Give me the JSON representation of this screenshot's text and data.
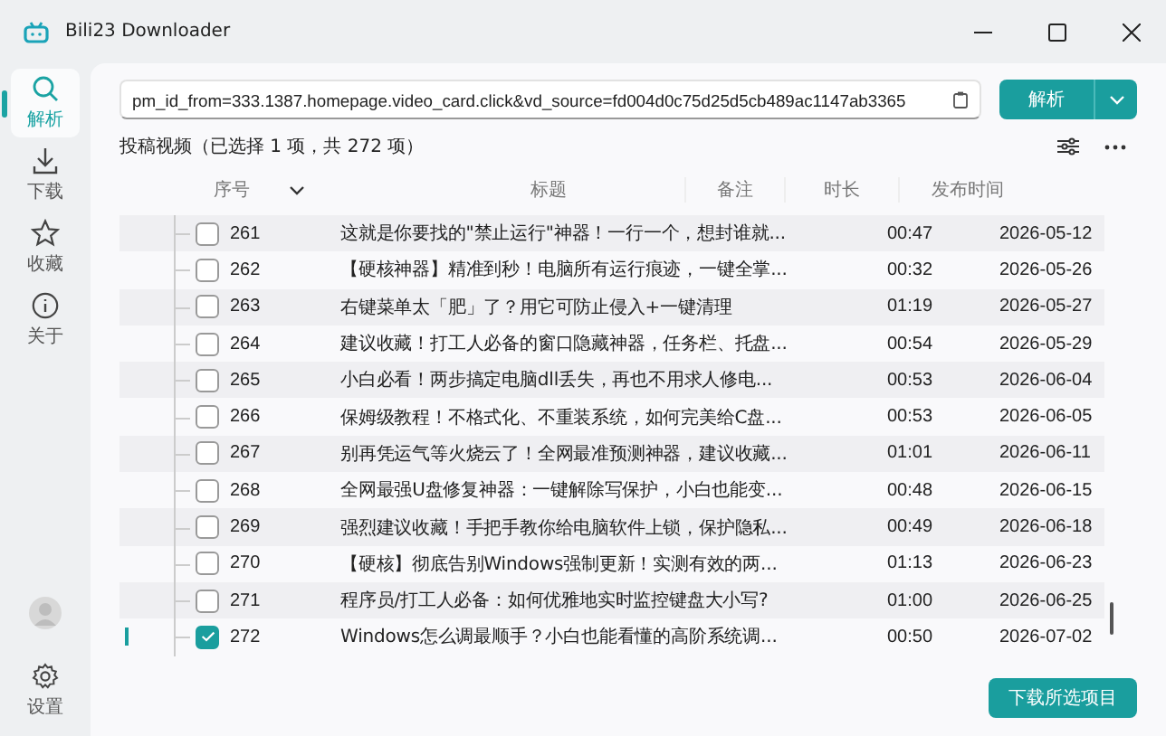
{
  "window": {
    "title": "Bili23 Downloader"
  },
  "sidebar": {
    "items": [
      {
        "label": "解析",
        "kind": "search",
        "selected": true
      },
      {
        "label": "下载",
        "kind": "download",
        "selected": false
      },
      {
        "label": "收藏",
        "kind": "star",
        "selected": false
      },
      {
        "label": "关于",
        "kind": "info",
        "selected": false
      }
    ],
    "settings": {
      "label": "设置"
    }
  },
  "url_field": {
    "value": "pm_id_from=333.1387.homepage.video_card.click&vd_source=fd004d0c75d25d5cb489ac1147ab3365"
  },
  "parse_button": {
    "label": "解析"
  },
  "list_title": "投稿视频（已选择 1 项，共 272 项）",
  "table": {
    "columns": [
      "序号",
      "标题",
      "备注",
      "时长",
      "发布时间"
    ],
    "rows": [
      {
        "number": "261",
        "title": "这就是你要找的\"禁止运行\"神器！一行一个，想封谁就...",
        "duration": "00:47",
        "date": "2026-05-12",
        "selected": false
      },
      {
        "number": "262",
        "title": "【硬核神器】精准到秒！电脑所有运行痕迹，一键全掌...",
        "duration": "00:32",
        "date": "2026-05-26",
        "selected": false
      },
      {
        "number": "263",
        "title": "右键菜单太「肥」了？用它可防止侵入+一键清理",
        "duration": "01:19",
        "date": "2026-05-27",
        "selected": false
      },
      {
        "number": "264",
        "title": "建议收藏！打工人必备的窗口隐藏神器，任务栏、托盘...",
        "duration": "00:54",
        "date": "2026-05-29",
        "selected": false
      },
      {
        "number": "265",
        "title": "小白必看！两步搞定电脑dll丢失，再也不用求人修电...",
        "duration": "00:53",
        "date": "2026-06-04",
        "selected": false
      },
      {
        "number": "266",
        "title": "保姆级教程！不格式化、不重装系统，如何完美给C盘...",
        "duration": "00:53",
        "date": "2026-06-05",
        "selected": false
      },
      {
        "number": "267",
        "title": "别再凭运气等火烧云了！全网最准预测神器，建议收藏...",
        "duration": "01:01",
        "date": "2026-06-11",
        "selected": false
      },
      {
        "number": "268",
        "title": "全网最强U盘修复神器：一键解除写保护，小白也能变...",
        "duration": "00:48",
        "date": "2026-06-15",
        "selected": false
      },
      {
        "number": "269",
        "title": "强烈建议收藏！手把手教你给电脑软件上锁，保护隐私...",
        "duration": "00:49",
        "date": "2026-06-18",
        "selected": false
      },
      {
        "number": "270",
        "title": "【硬核】彻底告别Windows强制更新！实测有效的两...",
        "duration": "01:13",
        "date": "2026-06-23",
        "selected": false
      },
      {
        "number": "271",
        "title": "程序员/打工人必备：如何优雅地实时监控键盘大小写?",
        "duration": "01:00",
        "date": "2026-06-25",
        "selected": false
      },
      {
        "number": "272",
        "title": "Windows怎么调最顺手？小白也能看懂的高阶系统调...",
        "duration": "00:50",
        "date": "2026-07-02",
        "selected": true
      }
    ]
  },
  "download_button": {
    "label": "下载所选项目"
  }
}
